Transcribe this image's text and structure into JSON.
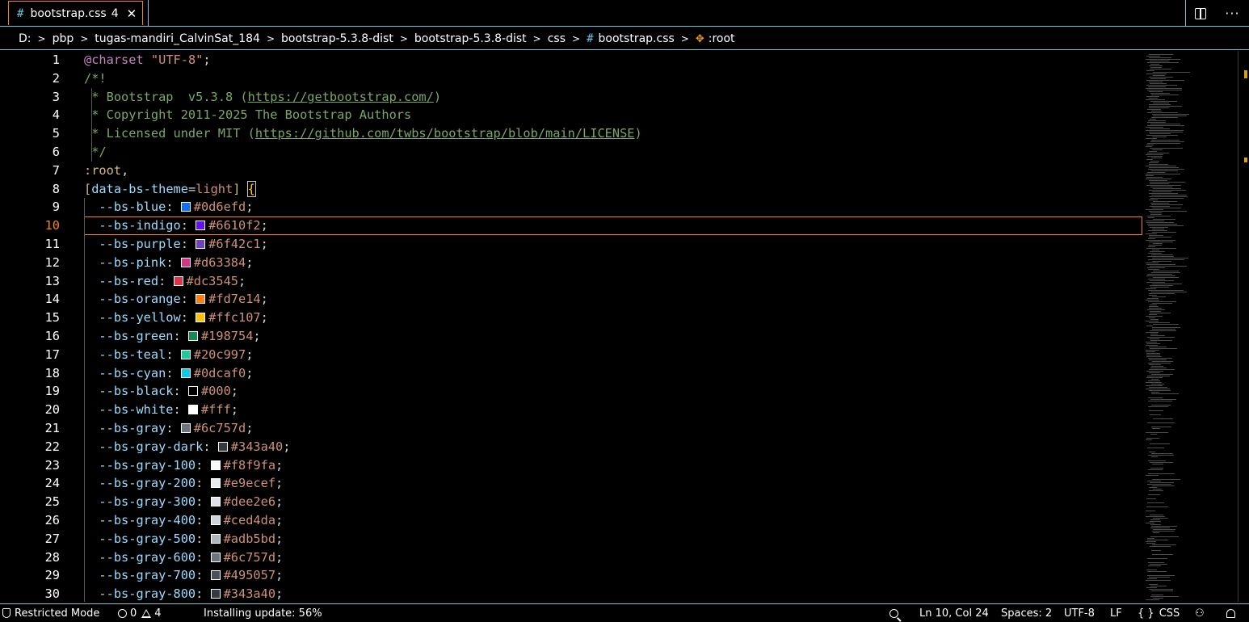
{
  "tab": {
    "title": "bootstrap.css",
    "problems_count": "4",
    "hash_glyph": "#",
    "close_glyph": "✕"
  },
  "tab_actions": {
    "split_icon": "split-editor-icon",
    "more_glyph": "···"
  },
  "breadcrumb": [
    "D:",
    "pbp",
    "tugas-mandiri_CalvinSat_184",
    "bootstrap-5.3.8-dist",
    "bootstrap-5.3.8-dist",
    "css"
  ],
  "breadcrumb_file": "bootstrap.css",
  "breadcrumb_symbol": ":root",
  "editor": {
    "active_line": 10,
    "header_lines": [
      {
        "n": "1",
        "parts": [
          {
            "c": "kw",
            "t": "@charset"
          },
          {
            "c": "plain",
            "t": " "
          },
          {
            "c": "str",
            "t": "\"UTF-8\""
          },
          {
            "c": "plain",
            "t": ";"
          }
        ]
      },
      {
        "n": "2",
        "parts": [
          {
            "c": "com",
            "t": "/*!"
          }
        ]
      },
      {
        "n": "3",
        "parts": [
          {
            "c": "com",
            "t": " * Bootstrap  v5.3.8 ("
          },
          {
            "c": "link",
            "t": "https://getbootstrap.com/"
          },
          {
            "c": "com",
            "t": ")"
          }
        ]
      },
      {
        "n": "4",
        "parts": [
          {
            "c": "com",
            "t": " * Copyright 2011-2025 The Bootstrap Authors"
          }
        ]
      },
      {
        "n": "5",
        "parts": [
          {
            "c": "com",
            "t": " * Licensed under MIT ("
          },
          {
            "c": "link",
            "t": "https://github.com/twbs/bootstrap/blob/main/LICENSE"
          },
          {
            "c": "com",
            "t": ")"
          }
        ]
      },
      {
        "n": "6",
        "parts": [
          {
            "c": "com",
            "t": " */"
          }
        ]
      },
      {
        "n": "7",
        "parts": [
          {
            "c": "sel",
            "t": ":root"
          },
          {
            "c": "plain",
            "t": ","
          }
        ]
      },
      {
        "n": "8",
        "parts": [
          {
            "c": "sel",
            "t": "["
          },
          {
            "c": "attr",
            "t": "data-bs-theme"
          },
          {
            "c": "plain",
            "t": "="
          },
          {
            "c": "str",
            "t": "light"
          },
          {
            "c": "sel",
            "t": "]"
          },
          {
            "c": "plain",
            "t": " "
          },
          {
            "c": "brk",
            "t": "{"
          }
        ]
      }
    ],
    "variables": [
      {
        "n": "9",
        "prop": "--bs-blue",
        "value": "#0d6efd",
        "swatch": "#0d6efd"
      },
      {
        "n": "10",
        "prop": "--bs-indigo",
        "value": "#6610f2",
        "swatch": "#6610f2"
      },
      {
        "n": "11",
        "prop": "--bs-purple",
        "value": "#6f42c1",
        "swatch": "#6f42c1"
      },
      {
        "n": "12",
        "prop": "--bs-pink",
        "value": "#d63384",
        "swatch": "#d63384"
      },
      {
        "n": "13",
        "prop": "--bs-red",
        "value": "#dc3545",
        "swatch": "#dc3545"
      },
      {
        "n": "14",
        "prop": "--bs-orange",
        "value": "#fd7e14",
        "swatch": "#fd7e14"
      },
      {
        "n": "15",
        "prop": "--bs-yellow",
        "value": "#ffc107",
        "swatch": "#ffc107"
      },
      {
        "n": "16",
        "prop": "--bs-green",
        "value": "#198754",
        "swatch": "#198754"
      },
      {
        "n": "17",
        "prop": "--bs-teal",
        "value": "#20c997",
        "swatch": "#20c997"
      },
      {
        "n": "18",
        "prop": "--bs-cyan",
        "value": "#0dcaf0",
        "swatch": "#0dcaf0"
      },
      {
        "n": "19",
        "prop": "--bs-black",
        "value": "#000",
        "swatch": "#000000"
      },
      {
        "n": "20",
        "prop": "--bs-white",
        "value": "#fff",
        "swatch": "#ffffff"
      },
      {
        "n": "21",
        "prop": "--bs-gray",
        "value": "#6c757d",
        "swatch": "#6c757d"
      },
      {
        "n": "22",
        "prop": "--bs-gray-dark",
        "value": "#343a40",
        "swatch": "#343a40"
      },
      {
        "n": "23",
        "prop": "--bs-gray-100",
        "value": "#f8f9fa",
        "swatch": "#f8f9fa"
      },
      {
        "n": "24",
        "prop": "--bs-gray-200",
        "value": "#e9ecef",
        "swatch": "#e9ecef"
      },
      {
        "n": "25",
        "prop": "--bs-gray-300",
        "value": "#dee2e6",
        "swatch": "#dee2e6"
      },
      {
        "n": "26",
        "prop": "--bs-gray-400",
        "value": "#ced4da",
        "swatch": "#ced4da"
      },
      {
        "n": "27",
        "prop": "--bs-gray-500",
        "value": "#adb5bd",
        "swatch": "#adb5bd"
      },
      {
        "n": "28",
        "prop": "--bs-gray-600",
        "value": "#6c757d",
        "swatch": "#6c757d"
      },
      {
        "n": "29",
        "prop": "--bs-gray-700",
        "value": "#495057",
        "swatch": "#495057"
      },
      {
        "n": "30",
        "prop": "--bs-gray-800",
        "value": "#343a40",
        "swatch": "#343a40"
      }
    ]
  },
  "statusbar": {
    "restricted_mode": "Restricted Mode",
    "errors": "0",
    "warnings": "4",
    "update": "Installing update: 56%",
    "cursor": "Ln 10, Col 24",
    "spaces": "Spaces: 2",
    "encoding": "UTF-8",
    "eol": "LF",
    "language_glyph": "{ }",
    "language": "CSS"
  },
  "colors": {
    "accent_border": "#f38518",
    "contrast_border": "#6fc3df",
    "scroll_marker": "#d4a017"
  }
}
